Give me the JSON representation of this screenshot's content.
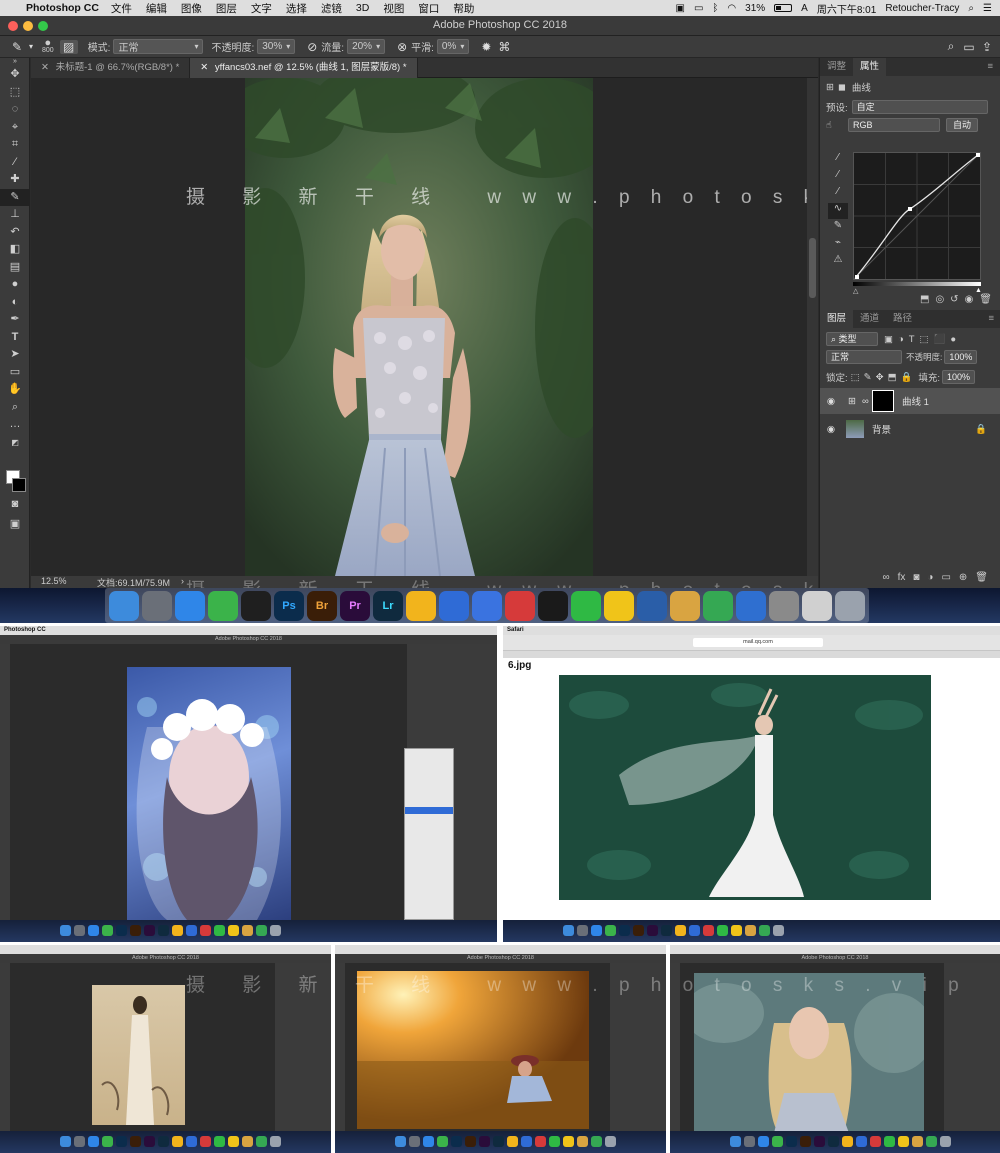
{
  "menubar": {
    "apple": "",
    "app_name": "Photoshop CC",
    "items": [
      "文件",
      "编辑",
      "图像",
      "图层",
      "文字",
      "选择",
      "滤镜",
      "3D",
      "视图",
      "窗口",
      "帮助"
    ],
    "battery": "31%",
    "clock": "周六下午8:01",
    "user": "Retoucher-Tracy"
  },
  "window": {
    "title": "Adobe Photoshop CC 2018"
  },
  "options_bar": {
    "brush_size": "800",
    "mode_label": "模式:",
    "mode_value": "正常",
    "opacity_label": "不透明度:",
    "opacity_value": "30%",
    "flow_label": "流量:",
    "flow_value": "20%",
    "smooth_label": "平滑:",
    "smooth_value": "0%"
  },
  "doc_tabs": [
    {
      "label": "未标题-1 @ 66.7%(RGB/8*) *"
    },
    {
      "label": "yffancs03.nef @ 12.5% (曲线 1, 图层蒙版/8) *"
    }
  ],
  "status": {
    "zoom": "12.5%",
    "doc": "文档:69.1M/75.9M"
  },
  "watermark": {
    "cn": "摄 影 新 干 线",
    "url": "w w w . p h o t o s k s . v i p"
  },
  "properties_panel": {
    "tabs": [
      "调整",
      "属性"
    ],
    "title": "曲线",
    "preset_label": "预设:",
    "preset_value": "自定",
    "channel": "RGB",
    "auto": "自动"
  },
  "layers_panel": {
    "tabs": [
      "图层",
      "通道",
      "路径"
    ],
    "kind_filter": "类型",
    "blend_mode": "正常",
    "opacity_label": "不透明度:",
    "opacity_value": "100%",
    "lock_label": "锁定:",
    "fill_label": "填充:",
    "fill_value": "100%",
    "layers": [
      {
        "name": "曲线 1"
      },
      {
        "name": "背景"
      }
    ]
  },
  "dock_apps": [
    {
      "label": "",
      "icon": "finder-icon",
      "color": "#3d8bdc"
    },
    {
      "label": "",
      "icon": "launchpad-icon",
      "color": "#6a6f78"
    },
    {
      "label": "",
      "icon": "safari-icon",
      "color": "#2f86e8"
    },
    {
      "label": "",
      "icon": "wechat-icon",
      "color": "#3bb34a"
    },
    {
      "label": "",
      "icon": "qq-icon",
      "color": "#1f1f1f"
    },
    {
      "label": "Ps",
      "icon": "photoshop-icon",
      "color": "#0b2c4c"
    },
    {
      "label": "Br",
      "icon": "bridge-icon",
      "color": "#3a1e08"
    },
    {
      "label": "Pr",
      "icon": "premiere-icon",
      "color": "#2a0c3a"
    },
    {
      "label": "Lr",
      "icon": "lightroom-icon",
      "color": "#0f2a3e"
    },
    {
      "label": "",
      "icon": "cc-icon",
      "color": "#f2b41c"
    },
    {
      "label": "",
      "icon": "baidu-netdisk-icon",
      "color": "#2f6bd6"
    },
    {
      "label": "",
      "icon": "photo-app-icon",
      "color": "#3a73e0"
    },
    {
      "label": "",
      "icon": "video-player-icon",
      "color": "#d63a3a"
    },
    {
      "label": "",
      "icon": "obs-icon",
      "color": "#1a1a1a"
    },
    {
      "label": "",
      "icon": "iqiyi-icon",
      "color": "#2fb944"
    },
    {
      "label": "",
      "icon": "music-icon",
      "color": "#f0c419"
    },
    {
      "label": "",
      "icon": "quicktime-icon",
      "color": "#2a5ea8"
    },
    {
      "label": "",
      "icon": "preview-icon",
      "color": "#d9a441"
    },
    {
      "label": "",
      "icon": "numbers-icon",
      "color": "#35a853"
    },
    {
      "label": "",
      "icon": "keynote-icon",
      "color": "#2f6fd0"
    },
    {
      "label": "",
      "icon": "display-icon",
      "color": "#8a8a8a"
    },
    {
      "label": "",
      "icon": "scanner-icon",
      "color": "#d0d0d0"
    },
    {
      "label": "",
      "icon": "trash-icon",
      "color": "#9aa2ad"
    }
  ],
  "thumb_topleft": {
    "app": "Photoshop CC",
    "title": "Adobe Photoshop CC 2018"
  },
  "thumb_topright": {
    "app": "Safari",
    "url": "mail.qq.com",
    "file": "6.jpg"
  },
  "thumb_bottom": [
    {
      "title": "Adobe Photoshop CC 2018"
    },
    {
      "title": "Adobe Photoshop CC 2018"
    },
    {
      "title": "Adobe Photoshop CC 2018"
    }
  ]
}
